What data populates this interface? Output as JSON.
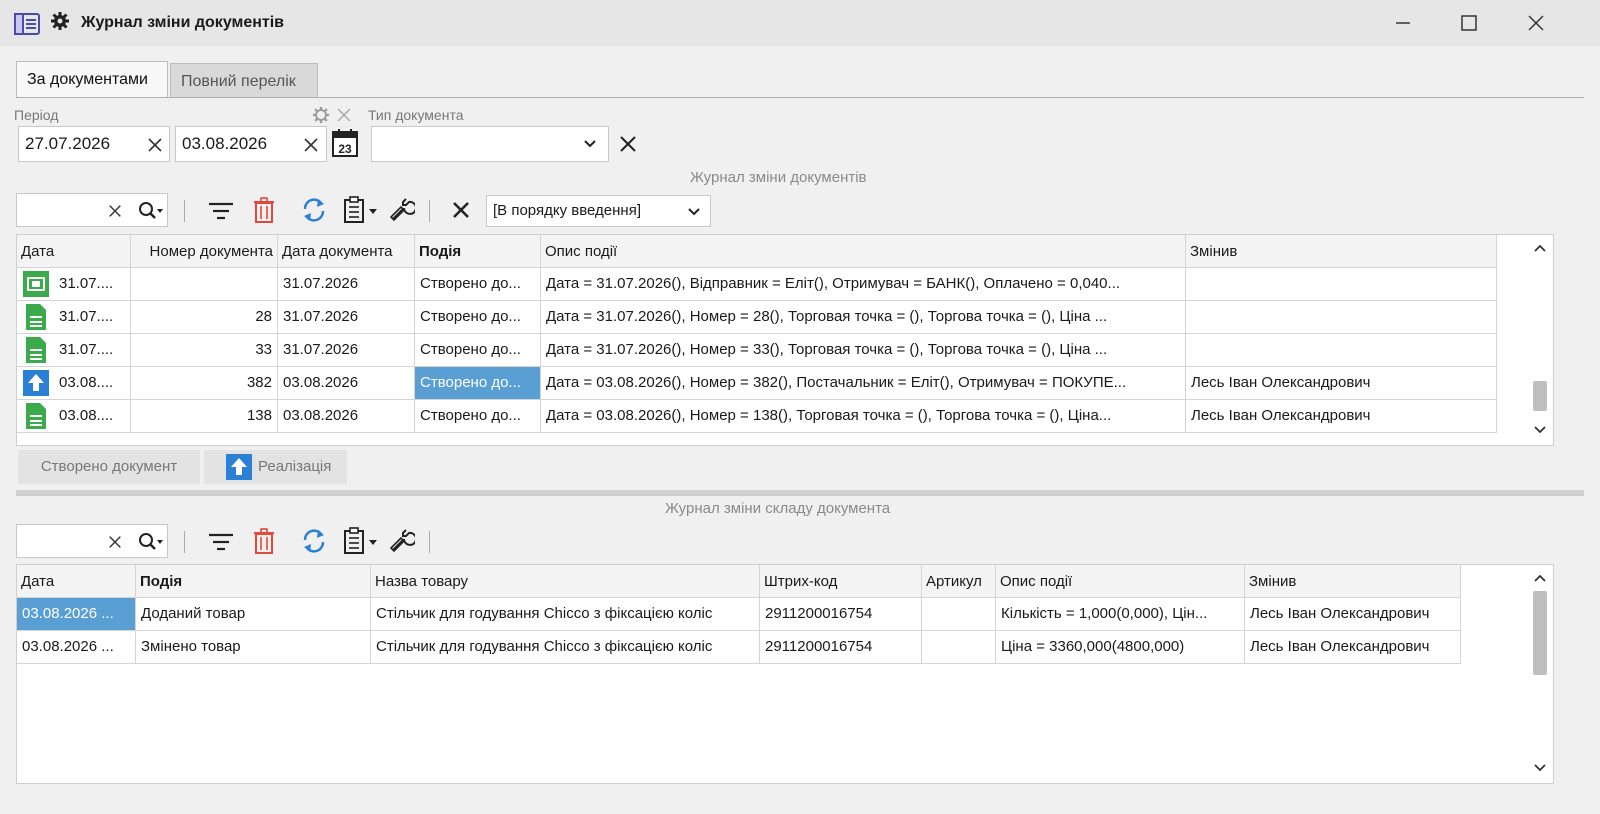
{
  "window": {
    "title": "Журнал зміни документів"
  },
  "tabs": [
    {
      "label": "За документами",
      "active": true
    },
    {
      "label": "Повний перелік",
      "active": false
    }
  ],
  "filters": {
    "period_label": "Період",
    "date_from": "27.07.2026",
    "date_to": "03.08.2026",
    "doc_type_label": "Тип документа",
    "doc_type_value": ""
  },
  "top_panel": {
    "caption": "Журнал зміни документів",
    "search_value": "",
    "sort_value": "[В порядку введення]",
    "columns": [
      "Дата",
      "Номер документа",
      "Дата документа",
      "Подія",
      "Опис події",
      "Змінив"
    ],
    "rows": [
      {
        "icon": "payment-doc-icon",
        "date": "31.07....",
        "number": "",
        "doc_date": "31.07.2026",
        "event": "Створено до...",
        "description": "Дата = 31.07.2026(), Відправник = Еліт(), Отримувач = БАНК(), Оплачено = 0,040...",
        "changed_by": ""
      },
      {
        "icon": "document-icon",
        "date": "31.07....",
        "number": "28",
        "doc_date": "31.07.2026",
        "event": "Створено до...",
        "description": "Дата = 31.07.2026(), Номер = 28(), Торговая точка = (), Торгова точка = (), Ціна ...",
        "changed_by": ""
      },
      {
        "icon": "document-icon",
        "date": "31.07....",
        "number": "33",
        "doc_date": "31.07.2026",
        "event": "Створено до...",
        "description": "Дата = 31.07.2026(), Номер = 33(), Торговая точка = (), Торгова точка = (), Ціна ...",
        "changed_by": ""
      },
      {
        "icon": "sale-upload-icon",
        "date": "03.08....",
        "number": "382",
        "doc_date": "03.08.2026",
        "event": "Створено до...",
        "description": "Дата = 03.08.2026(), Номер = 382(), Постачальник = Еліт(), Отримувач = ПОКУПЕ...",
        "changed_by": "Лесь Іван Олександрович"
      },
      {
        "icon": "document-icon",
        "date": "03.08....",
        "number": "138",
        "doc_date": "03.08.2026",
        "event": "Створено до...",
        "description": "Дата = 03.08.2026(), Номер = 138(), Торговая точка = (), Торгова точка = (), Ціна...",
        "changed_by": "Лесь Іван Олександрович"
      }
    ],
    "chips": [
      "Створено документ",
      "Реалізація"
    ]
  },
  "bottom_panel": {
    "caption": "Журнал зміни складу документа",
    "search_value": "",
    "columns": [
      "Дата",
      "Подія",
      "Назва товару",
      "Штрих-код",
      "Артикул",
      "Опис події",
      "Змінив"
    ],
    "rows": [
      {
        "date": "03.08.2026 ...",
        "event": "Доданий товар",
        "product": "Стільчик для годування Chicco з фіксацією коліс",
        "barcode": "2911200016754",
        "article": "",
        "description": "Кількість = 1,000(0,000), Цін...",
        "changed_by": "Лесь Іван Олександрович"
      },
      {
        "date": "03.08.2026 ...",
        "event": "Змінено товар",
        "product": "Стільчик для годування Chicco з фіксацією коліс",
        "barcode": "2911200016754",
        "article": "",
        "description": "Ціна  = 3360,000(4800,000)",
        "changed_by": "Лесь Іван Олександрович"
      }
    ]
  },
  "colors": {
    "accent_blue": "#2b7fd4",
    "doc_green": "#3aaa4a",
    "delete_red": "#e04a3a",
    "selection": "#5a9fd4"
  }
}
